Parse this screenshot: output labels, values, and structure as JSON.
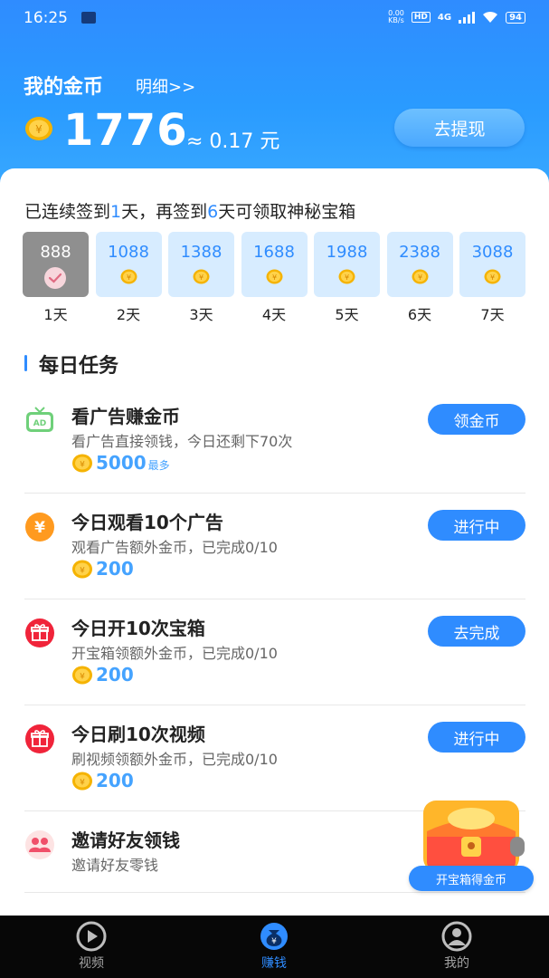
{
  "status_bar": {
    "time": "16:25",
    "speed_top": "0.00",
    "speed_unit": "KB/s",
    "hd": "HD",
    "net": "4G",
    "battery": "94"
  },
  "header": {
    "title": "我的金币",
    "detail_link": "明细>>",
    "coin_amount": "1776",
    "approx": "≈ 0.17 元",
    "withdraw_label": "去提现"
  },
  "signin": {
    "text_a": "已连续签到",
    "days_done": "1",
    "text_b": "天，再签到",
    "days_left": "6",
    "text_c": "天可领取神秘宝箱",
    "days": [
      {
        "value": "888",
        "label": "1天",
        "done": true
      },
      {
        "value": "1088",
        "label": "2天",
        "done": false
      },
      {
        "value": "1388",
        "label": "3天",
        "done": false
      },
      {
        "value": "1688",
        "label": "4天",
        "done": false
      },
      {
        "value": "1988",
        "label": "5天",
        "done": false
      },
      {
        "value": "2388",
        "label": "6天",
        "done": false
      },
      {
        "value": "3088",
        "label": "7天",
        "done": false
      }
    ]
  },
  "tasks_title": "每日任务",
  "tasks": [
    {
      "icon": "ad-tv-icon",
      "title": "看广告赚金币",
      "desc": "看广告直接领钱，今日还剩下70次",
      "reward": "5000",
      "reward_sub": "最多",
      "button": "领金币"
    },
    {
      "icon": "yuan-coin-icon",
      "title": "今日观看10个广告",
      "desc": "观看广告额外金币，已完成0/10",
      "reward": "200",
      "button": "进行中"
    },
    {
      "icon": "gift-icon",
      "title": "今日开10次宝箱",
      "desc": "开宝箱领额外金币，已完成0/10",
      "reward": "200",
      "button": "去完成"
    },
    {
      "icon": "gift-icon",
      "title": "今日刷10次视频",
      "desc": "刷视频领额外金币，已完成0/10",
      "reward": "200",
      "button": "进行中"
    },
    {
      "icon": "friends-icon",
      "title": "邀请好友领钱",
      "desc": "邀请好友零钱"
    }
  ],
  "treasure_label": "开宝箱得金币",
  "tabbar": [
    {
      "label": "视频",
      "icon": "play-icon",
      "active": false
    },
    {
      "label": "赚钱",
      "icon": "money-bag-icon",
      "active": true
    },
    {
      "label": "我的",
      "icon": "user-icon",
      "active": false
    }
  ],
  "colors": {
    "primary": "#2f8cff",
    "coin": "#f5b301",
    "tabbar_bg": "#070707"
  }
}
